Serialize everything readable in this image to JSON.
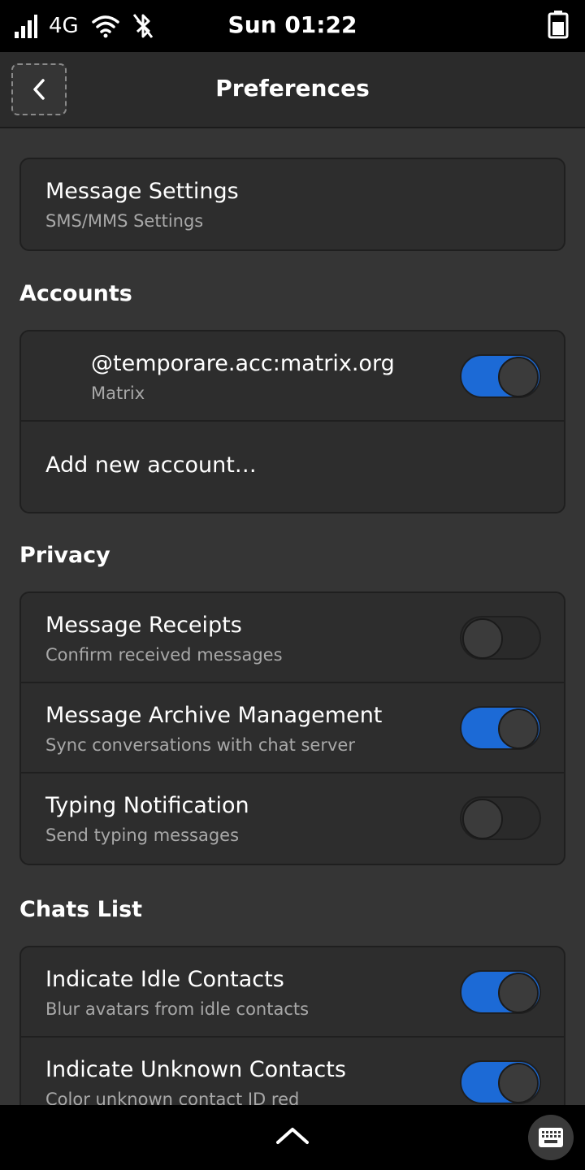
{
  "status_bar": {
    "network": "4G",
    "clock": "Sun 01:22",
    "icons": [
      "signal-icon",
      "wifi-icon",
      "bluetooth-icon",
      "battery-icon"
    ]
  },
  "header": {
    "title": "Preferences",
    "back_icon": "chevron-left-icon"
  },
  "message_settings": {
    "title": "Message Settings",
    "subtitle": "SMS/MMS Settings"
  },
  "accounts": {
    "heading": "Accounts",
    "items": [
      {
        "title": "@temporare.acc:matrix.org",
        "subtitle": "Matrix",
        "enabled": true
      }
    ],
    "add_label": "Add new account…"
  },
  "privacy": {
    "heading": "Privacy",
    "items": [
      {
        "title": "Message Receipts",
        "subtitle": "Confirm received messages",
        "enabled": false
      },
      {
        "title": "Message Archive Management",
        "subtitle": "Sync conversations with chat server",
        "enabled": true
      },
      {
        "title": "Typing Notification",
        "subtitle": "Send typing messages",
        "enabled": false
      }
    ]
  },
  "chats_list": {
    "heading": "Chats List",
    "items": [
      {
        "title": "Indicate Idle Contacts",
        "subtitle": "Blur avatars from idle contacts",
        "enabled": true
      },
      {
        "title": "Indicate Unknown Contacts",
        "subtitle": "Color unknown contact ID red",
        "enabled": true
      }
    ]
  },
  "bottom_bar": {
    "icons": [
      "chevron-up-icon",
      "keyboard-icon"
    ]
  },
  "colors": {
    "accent": "#1c6ad6",
    "background": "#353535",
    "card": "#2d2d2d",
    "subtitle": "#a8a8a8"
  }
}
